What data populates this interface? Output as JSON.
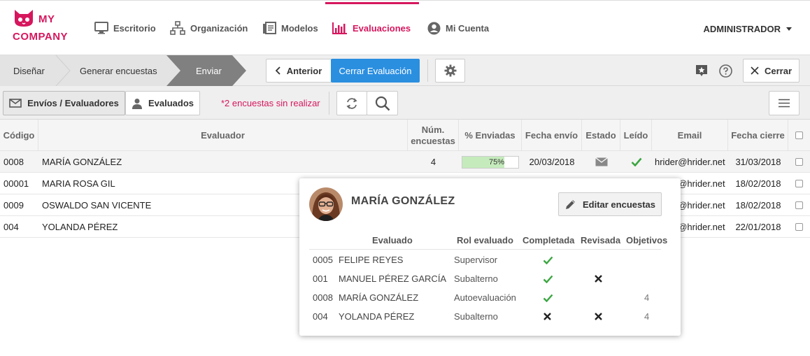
{
  "brand": {
    "line1": "MY",
    "line2": "COMPANY"
  },
  "nav": {
    "items": [
      {
        "label": "Escritorio",
        "icon": "monitor-icon"
      },
      {
        "label": "Organización",
        "icon": "org-chart-icon"
      },
      {
        "label": "Modelos",
        "icon": "document-stack-icon"
      },
      {
        "label": "Evaluaciones",
        "icon": "bar-chart-icon",
        "active": true
      },
      {
        "label": "Mi Cuenta",
        "icon": "user-circle-icon"
      }
    ],
    "user": "ADMINISTRADOR"
  },
  "steps": [
    "Diseñar",
    "Generar encuestas",
    "Enviar"
  ],
  "actions": {
    "prev": "Anterior",
    "close_eval": "Cerrar Evaluación",
    "close": "Cerrar"
  },
  "toolbar": {
    "tab_senders": "Envíos / Evaluadores",
    "tab_evaluated": "Evaluados",
    "pending": "*2 encuestas sin realizar"
  },
  "table": {
    "headers": {
      "code": "Código",
      "evaluator": "Evaluador",
      "num_line1": "Núm.",
      "num_line2": "encuestas",
      "sent_pct": "% Enviadas",
      "sent_date": "Fecha envío",
      "state": "Estado",
      "read": "Leído",
      "email": "Email",
      "close_date": "Fecha cierre"
    },
    "rows": [
      {
        "code": "0008",
        "name": "MARÍA GONZÁLEZ",
        "num": "4",
        "pct_label": "75%",
        "pct": 0.75,
        "date": "20/03/2018",
        "email": "hrider@hrider.net",
        "close": "31/03/2018"
      },
      {
        "code": "00001",
        "name": "MARIA ROSA GIL",
        "email": "hrider@hrider.net",
        "close": "18/02/2018"
      },
      {
        "code": "0009",
        "name": "OSWALDO SAN VICENTE",
        "email": "hrider@hrider.net",
        "close": "18/02/2018"
      },
      {
        "code": "004",
        "name": "YOLANDA PÉREZ",
        "email": "hrider@hrider.net",
        "close": "22/01/2018"
      }
    ]
  },
  "popup": {
    "name": "MARÍA GONZÁLEZ",
    "edit_label": "Editar encuestas",
    "headers": {
      "evaluated": "Evaluado",
      "role": "Rol evaluado",
      "completed": "Completada",
      "reviewed": "Revisada",
      "objectives": "Objetivos"
    },
    "rows": [
      {
        "code": "0005",
        "name": "FELIPE REYES",
        "role": "Supervisor",
        "completed": "check",
        "reviewed": "",
        "objectives": ""
      },
      {
        "code": "001",
        "name": "MANUEL PÉREZ GARCÍA",
        "role": "Subalterno",
        "completed": "check",
        "reviewed": "cross",
        "objectives": ""
      },
      {
        "code": "0008",
        "name": "MARÍA GONZÁLEZ",
        "role": "Autoevaluación",
        "completed": "check",
        "reviewed": "",
        "objectives": "4"
      },
      {
        "code": "004",
        "name": "YOLANDA PÉREZ",
        "role": "Subalterno",
        "completed": "cross",
        "reviewed": "cross",
        "objectives": "4"
      }
    ]
  },
  "colors": {
    "brand": "#d6175e",
    "primary": "#2b8fe0",
    "check": "#3aa640"
  }
}
